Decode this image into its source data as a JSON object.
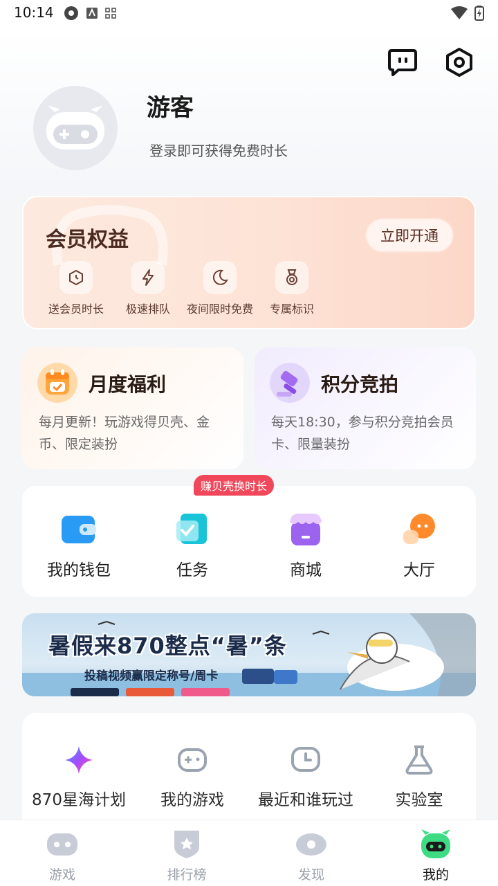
{
  "status": {
    "time": "10:14"
  },
  "profile": {
    "name": "游客",
    "login_hint": "登录即可获得免费时长"
  },
  "header_icons": [
    "message-icon",
    "settings-icon"
  ],
  "vip": {
    "title": "会员权益",
    "button": "立即开通",
    "benefits": [
      {
        "label": "送会员时长",
        "icon": "clock-icon"
      },
      {
        "label": "极速排队",
        "icon": "lightning-icon"
      },
      {
        "label": "夜间限时免费",
        "icon": "moon-icon"
      },
      {
        "label": "专属标识",
        "icon": "medal-icon"
      }
    ]
  },
  "monthly": {
    "title": "月度福利",
    "desc": "每月更新！玩游戏得贝壳、金币、限定装扮"
  },
  "auction": {
    "title": "积分竞拍",
    "desc": "每天18:30，参与积分竞拍会员卡、限量装扮"
  },
  "quick": {
    "badge": "赚贝壳换时长",
    "items": [
      {
        "label": "我的钱包",
        "icon": "wallet-icon"
      },
      {
        "label": "任务",
        "icon": "task-icon"
      },
      {
        "label": "商城",
        "icon": "shop-icon"
      },
      {
        "label": "大厅",
        "icon": "lobby-icon"
      }
    ]
  },
  "banner": {
    "title": "暑假来870整点“暑”条",
    "subtitle": "投稿视频赢限定称号/周卡"
  },
  "tools": [
    {
      "label": "870星海计划",
      "icon": "star-icon"
    },
    {
      "label": "我的游戏",
      "icon": "gamepad-icon"
    },
    {
      "label": "最近和谁玩过",
      "icon": "history-icon"
    },
    {
      "label": "实验室",
      "icon": "flask-icon"
    }
  ],
  "nav": [
    {
      "label": "游戏",
      "icon": "game-icon",
      "active": false
    },
    {
      "label": "排行榜",
      "icon": "ranking-icon",
      "active": false
    },
    {
      "label": "发现",
      "icon": "discover-icon",
      "active": false
    },
    {
      "label": "我的",
      "icon": "mine-icon",
      "active": true
    }
  ],
  "colors": {
    "accent_red": "#f0475a",
    "vip_peach": "#fde3d6",
    "active_green": "#3ddc84"
  }
}
